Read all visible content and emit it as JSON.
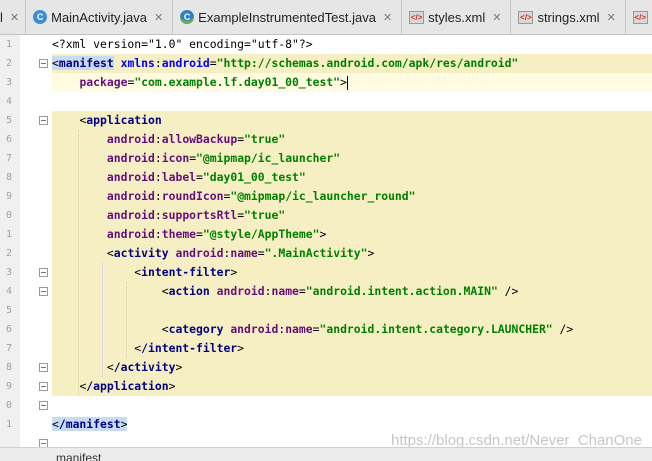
{
  "tabs": [
    {
      "label": "l",
      "icon": "none"
    },
    {
      "label": "MainActivity.java",
      "icon": "c-class-icon"
    },
    {
      "label": "ExampleInstrumentedTest.java",
      "icon": "c-test-class-icon"
    },
    {
      "label": "styles.xml",
      "icon": "xml-file-icon"
    },
    {
      "label": "strings.xml",
      "icon": "xml-file-icon"
    },
    {
      "label": "colo",
      "icon": "xml-file-icon"
    }
  ],
  "gutter_numbers": [
    "1",
    "2",
    "3",
    "4",
    "5",
    "6",
    "7",
    "8",
    "9",
    "0",
    "1",
    "2",
    "3",
    "4",
    "5",
    "6",
    "7",
    "8",
    "9",
    "0",
    "1"
  ],
  "code": {
    "l1_pi": "<?xml version=\"1.0\" encoding=\"utf-8\"?>",
    "l2_tag": "manifest",
    "l2_ns": "xmlns",
    "l2_attr": "android",
    "l2_val": "\"http://schemas.android.com/apk/res/android\"",
    "l3_attr": "package",
    "l3_val": "\"com.example.lf.day01_00_test\"",
    "l5_tag": "application",
    "l6_attr": "allowBackup",
    "l6_val": "\"true\"",
    "l7_attr": "icon",
    "l7_val": "\"@mipmap/ic_launcher\"",
    "l8_attr": "label",
    "l8_val": "\"day01_00_test\"",
    "l9_attr": "roundIcon",
    "l9_val": "\"@mipmap/ic_launcher_round\"",
    "l10_attr": "supportsRtl",
    "l10_val": "\"true\"",
    "l11_attr": "theme",
    "l11_val": "\"@style/AppTheme\"",
    "l12_tag": "activity",
    "l12_attr": "name",
    "l12_val": "\".MainActivity\"",
    "l13_tag": "intent-filter",
    "l14_tag": "action",
    "l14_attr": "name",
    "l14_val": "\"android.intent.action.MAIN\"",
    "l16_tag": "category",
    "l16_attr": "name",
    "l16_val": "\"android.intent.category.LAUNCHER\"",
    "l17_tag": "/intent-filter",
    "l18_tag": "/activity",
    "l19_tag": "/application",
    "l21_tag": "/manifest",
    "android_prefix": "android",
    "colon": ":"
  },
  "watermark": "https://blog.csdn.net/Never_ChanOne",
  "breadcrumb": "manifest",
  "colors": {
    "tag": "#000080",
    "attribute": "#660e7a",
    "value": "#008000",
    "highlight_band": "#f6efc4",
    "tag_match": "#c7dbf4"
  }
}
